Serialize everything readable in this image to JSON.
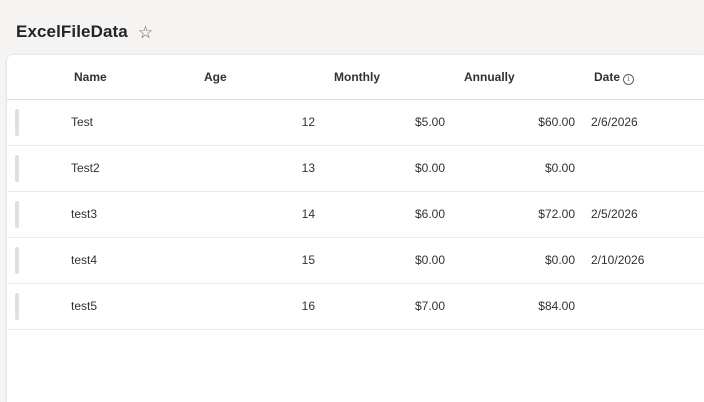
{
  "page": {
    "title": "ExcelFileData",
    "favorite_icon": "star-outline-icon"
  },
  "table": {
    "columns": {
      "name": "Name",
      "age": "Age",
      "monthly": "Monthly",
      "annually": "Annually",
      "date": "Date",
      "date_info_icon": "info-icon"
    },
    "rows": [
      {
        "name": "Test",
        "age": "12",
        "monthly": "$5.00",
        "annually": "$60.00",
        "date": "2/6/2026"
      },
      {
        "name": "Test2",
        "age": "13",
        "monthly": "$0.00",
        "annually": "$0.00",
        "date": ""
      },
      {
        "name": "test3",
        "age": "14",
        "monthly": "$6.00",
        "annually": "$72.00",
        "date": "2/5/2026"
      },
      {
        "name": "test4",
        "age": "15",
        "monthly": "$0.00",
        "annually": "$0.00",
        "date": "2/10/2026"
      },
      {
        "name": "test5",
        "age": "16",
        "monthly": "$7.00",
        "annually": "$84.00",
        "date": ""
      }
    ]
  }
}
